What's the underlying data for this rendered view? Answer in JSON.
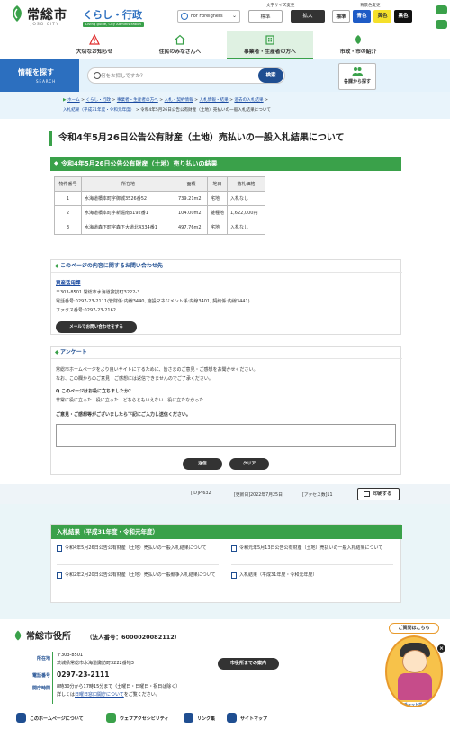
{
  "header": {
    "city_name": "常総市",
    "city_name_en": "JOSO CITY",
    "section": "くらし・行政",
    "section_sub": "Living guide, City Administration",
    "foreign_label": "For Foreigners",
    "font_size_label": "文字サイズ変更",
    "font_size_options": [
      "標準",
      "拡大"
    ],
    "bg_color_label": "背景色変更",
    "bg_color_options": [
      "標準",
      "青色",
      "黄色",
      "黒色"
    ]
  },
  "nav": {
    "items": [
      "大切なお知らせ",
      "住民のみなさんへ",
      "事業者・生産者の方へ",
      "市政・市の紹介"
    ],
    "active_index": 2
  },
  "search": {
    "label": "情報を探す",
    "label_en": "SEARCH",
    "placeholder": "何をお探しですか？",
    "button": "検索",
    "by_department": "各課から探す"
  },
  "breadcrumb": {
    "items": [
      "ホーム",
      "くらし・行政",
      "事業者・生産者の方へ",
      "入札・契約情報",
      "入札情報・結果",
      "過去の入札結果",
      "入札結果（平成31年度・令和元年度）"
    ],
    "current": "令和4年5月26日公告公有財産（土地）売払いの一般入札結果について"
  },
  "page": {
    "title": "令和4年5月26日公告公有財産（土地）売払いの一般入札結果について",
    "section_title": "令和4年5月26日公告公有財産（土地）売り払いの結果",
    "table": {
      "headers": [
        "物件番号",
        "所在地",
        "面積",
        "地目",
        "落札価格"
      ],
      "rows": [
        [
          "1",
          "水海道橋本町字御城3526番52",
          "739.21m2",
          "宅地",
          "入札なし"
        ],
        [
          "2",
          "水海道橋本町字新堀南3192番1",
          "104.00m2",
          "雑種地",
          "1,622,000円"
        ],
        [
          "3",
          "水海道森下町字森下大道北4334番1",
          "497.76m2",
          "宅地",
          "入札なし"
        ]
      ]
    }
  },
  "inquiry": {
    "heading": "このページの内容に関するお問い合わせ先",
    "department": "資産活用課",
    "address": "〒303-8501 常総市水海道諏訪町3222-3",
    "phone": "電話番号:0297-23-2111(管財係:内線3440, 施設マネジメント係:内線3401, 契約係:内線3441)",
    "fax": "ファクス番号:0297-23-2162",
    "mail_button": "メールでお問い合わせをする"
  },
  "survey": {
    "heading": "アンケート",
    "intro_1": "常総市ホームページをより良いサイトにするために、皆さまのご意見・ご感想をお聞かせください。",
    "intro_2": "なお、この欄からのご意見・ご感想には返信できませんのでご了承ください。",
    "question": "Q.このページはお役に立ちましたか？",
    "options": [
      "非常に役に立った",
      "役に立った",
      "どちらともいえない",
      "役に立たなかった"
    ],
    "comment_label": "ご意見・ご感想等がございましたら下記にご入力し送信ください。",
    "submit": "送信",
    "clear": "クリア"
  },
  "info": {
    "id": "[ID]P-632",
    "updated": "[更新日]2022年7月25日",
    "access": "[アクセス数]11",
    "print": "印刷する"
  },
  "related": {
    "heading": "入札結果（平成31年度・令和元年度）",
    "items": [
      "令和4年5月26日公告公有財産（土地）売払いの一般入札結果について",
      "令和元年5月13日公告公有財産（土地）売払いの一般入札結果について",
      "令和2年2月20日公告公有財産（土地）売払いの一般競争入札結果について",
      "入札結果（平成31年度・令和元年度）"
    ]
  },
  "footer": {
    "office_name": "常総市役所",
    "corp_number": "（法人番号：6000020082112）",
    "address_label": "所在地",
    "postal": "〒303-8501",
    "address": "茨城県常総市水海道諏訪町3222番地3",
    "phone_label": "電話番号",
    "phone": "0297-23-2111",
    "hours_label": "開庁時間",
    "hours": "8時30分から17時15分まで（土曜日・日曜日・祝日は除く）",
    "hours_note_prefix": "詳しくは",
    "hours_link": "日曜日窓口開庁について",
    "hours_note_suffix": "をご覧ください。",
    "map_button": "市役所までの案内",
    "links": [
      "このホームページについて",
      "ウェブアクセシビリティ",
      "リンク集",
      "サイトマップ"
    ]
  },
  "mascot": {
    "bubble": "ご質問はこちら",
    "label": "チャットボット"
  },
  "colors": {
    "accent_green": "#3aa14a",
    "brand_blue": "#2c6fbf",
    "navy": "#1f4e91"
  }
}
